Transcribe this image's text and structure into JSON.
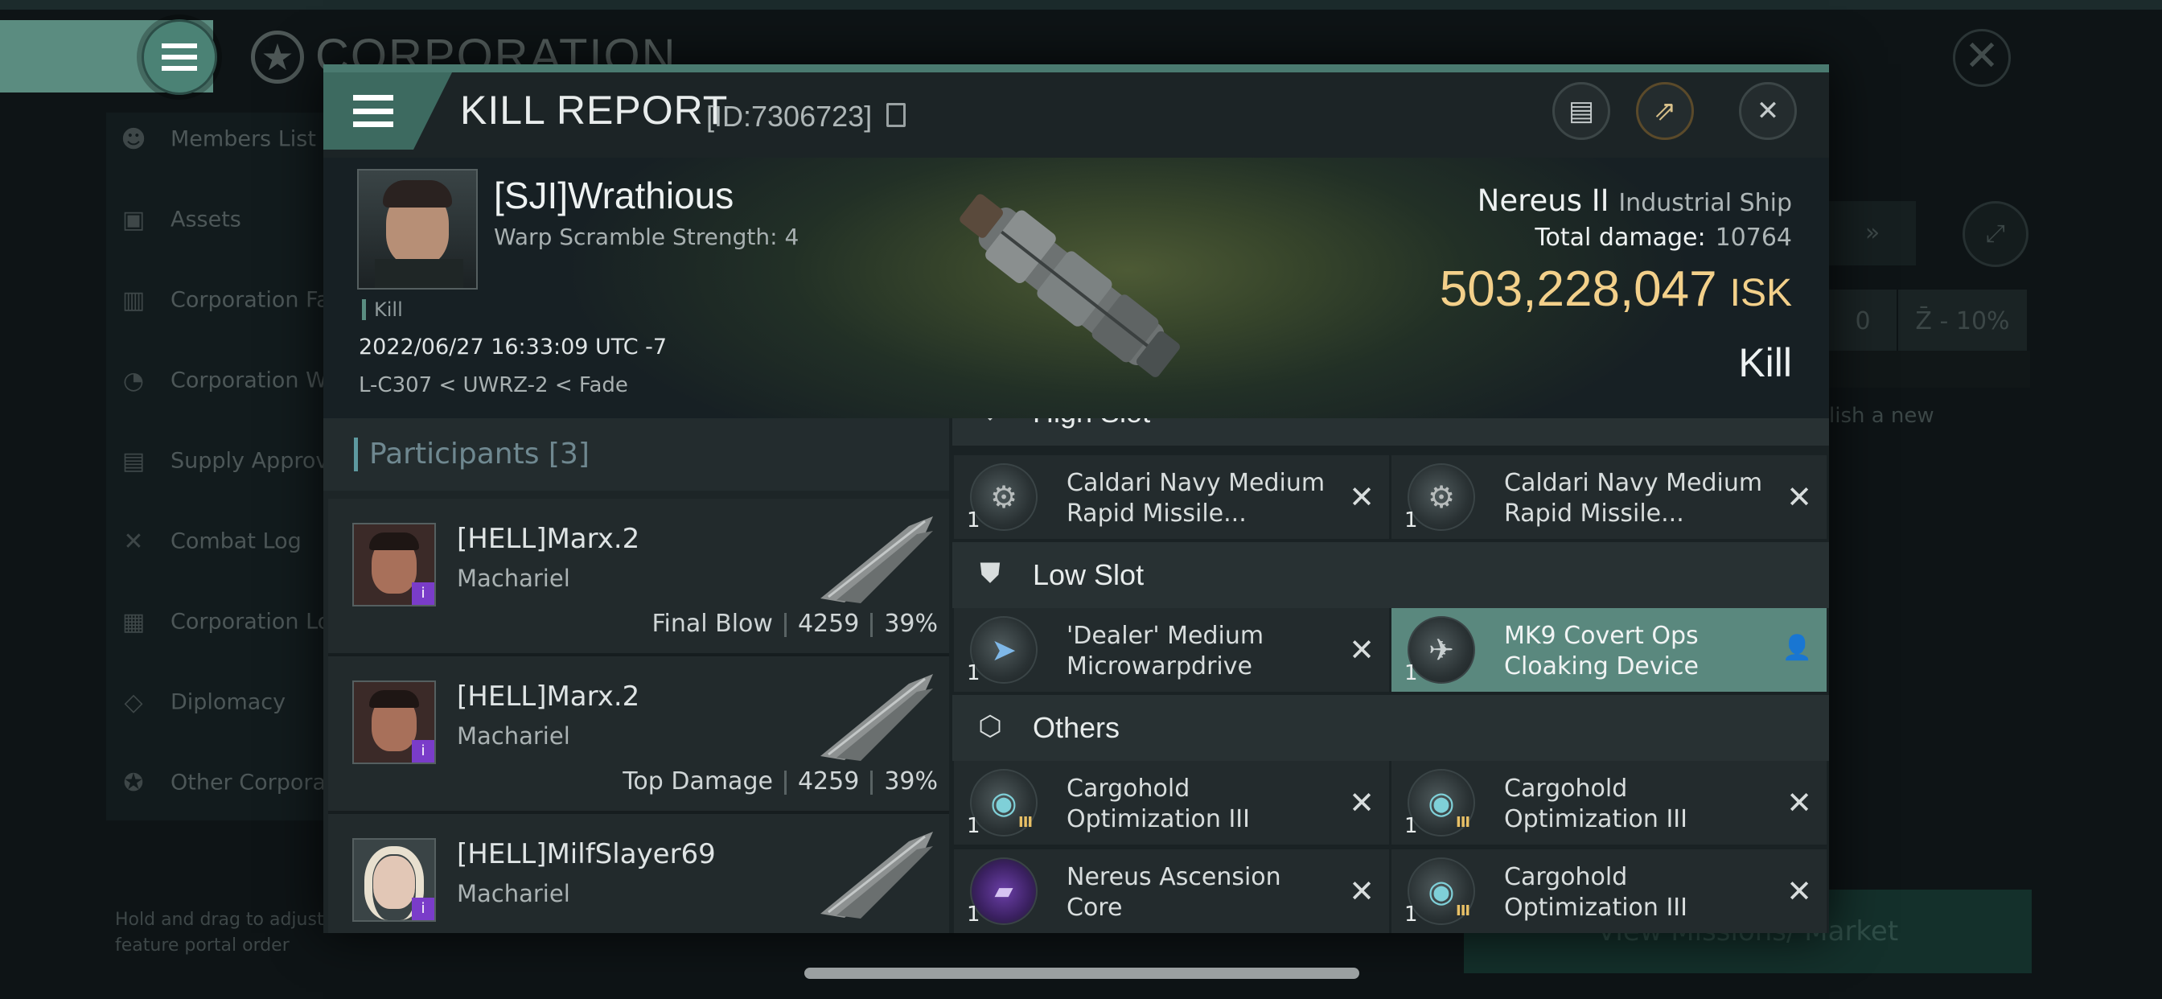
{
  "background": {
    "title": "CORPORATION",
    "sidebar": [
      {
        "label": "Members List",
        "icon": "members-icon"
      },
      {
        "label": "Assets",
        "icon": "assets-icon"
      },
      {
        "label": "Corporation Fa",
        "icon": "facilities-icon"
      },
      {
        "label": "Corporation Wa",
        "icon": "wallet-icon"
      },
      {
        "label": "Supply Approva",
        "icon": "supply-icon"
      },
      {
        "label": "Combat Log",
        "icon": "combat-icon"
      },
      {
        "label": "Corporation Lo",
        "icon": "log-icon"
      },
      {
        "label": "Diplomacy",
        "icon": "diplomacy-icon"
      },
      {
        "label": "Other Corporat",
        "icon": "other-corp-icon"
      }
    ],
    "hint": "Hold and drag to adjust feature portal order",
    "right_value_0": "0",
    "right_value_pct": "- 10%",
    "right_text": "lish a new",
    "bottom_button": "View Missions/ Market"
  },
  "kill_report": {
    "title": "KILL REPORT",
    "id": "[ID:7306723]",
    "victim": {
      "name": "[SJI]Wrathious",
      "subtitle": "Warp Scramble Strength: 4",
      "tag": "Kill",
      "datetime": "2022/06/27 16:33:09 UTC -7",
      "location": "L-C307 < UWRZ-2 < Fade"
    },
    "ship": {
      "name": "Nereus II",
      "class": "Industrial Ship",
      "damage_label": "Total damage:",
      "damage_value": "10764",
      "isk_value": "503,228,047",
      "isk_unit": "ISK",
      "result": "Kill"
    },
    "participants": {
      "label": "Participants",
      "count": "[3]",
      "rows": [
        {
          "name": "[HELL]Marx.2",
          "ship": "Machariel",
          "stat_label": "Final Blow",
          "damage": "4259",
          "pct": "39%"
        },
        {
          "name": "[HELL]Marx.2",
          "ship": "Machariel",
          "stat_label": "Top Damage",
          "damage": "4259",
          "pct": "39%"
        },
        {
          "name": "[HELL]MilfSlayer69",
          "ship": "Machariel",
          "stat_label": "",
          "damage": "",
          "pct": ""
        }
      ]
    },
    "fittings": {
      "high_slot": {
        "label": "High Slot",
        "items": [
          {
            "name": "Caldari Navy Medium Rapid Missile...",
            "qty": "1"
          },
          {
            "name": "Caldari Navy Medium Rapid Missile...",
            "qty": "1"
          }
        ]
      },
      "low_slot": {
        "label": "Low Slot",
        "items": [
          {
            "name": "'Dealer' Medium Microwarpdrive",
            "qty": "1"
          },
          {
            "name": "MK9 Covert Ops Cloaking Device",
            "qty": "1"
          }
        ]
      },
      "others": {
        "label": "Others",
        "items": [
          {
            "name": "Cargohold Optimization III",
            "qty": "1"
          },
          {
            "name": "Cargohold Optimization III",
            "qty": "1"
          },
          {
            "name": "Nereus Ascension Core",
            "qty": "1"
          },
          {
            "name": "Cargohold Optimization III",
            "qty": "1"
          }
        ]
      },
      "tier_mark": "III"
    }
  }
}
